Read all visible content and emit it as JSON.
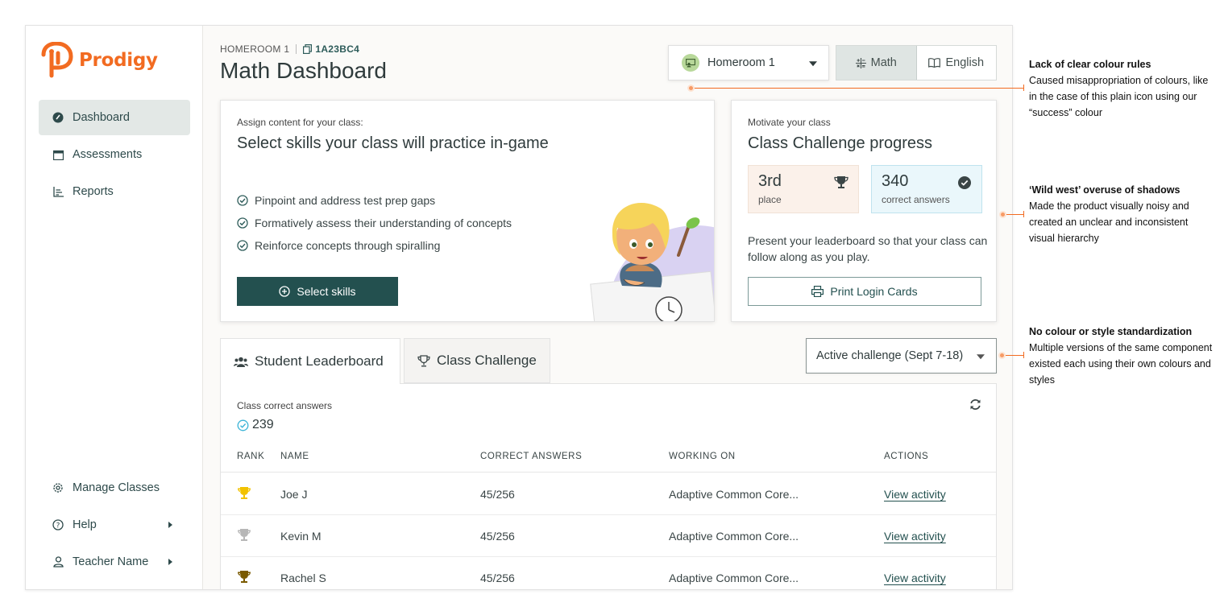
{
  "brand": {
    "name": "Prodigy",
    "color": "#f26b21"
  },
  "sidebar": {
    "items": [
      {
        "label": "Dashboard",
        "icon": "dashboard-gauge-icon",
        "active": true
      },
      {
        "label": "Assessments",
        "icon": "calendar-icon"
      },
      {
        "label": "Reports",
        "icon": "bar-chart-icon"
      }
    ],
    "bottom": [
      {
        "label": "Manage Classes",
        "icon": "gear-icon"
      },
      {
        "label": "Help",
        "icon": "help-circle-icon"
      },
      {
        "label": "Teacher Name",
        "icon": "user-icon"
      }
    ]
  },
  "header": {
    "homeroom": "HOMEROOM 1",
    "class_code": "1A23BC4",
    "title": "Math Dashboard",
    "class_select": "Homeroom 1",
    "subjects": [
      "Math",
      "English"
    ]
  },
  "skills_card": {
    "label": "Assign content for your class:",
    "title": "Select skills your class will practice in-game",
    "bullets": [
      "Pinpoint and address test prep gaps",
      "Formatively assess their understanding of concepts",
      "Reinforce concepts through spiralling"
    ],
    "button": "Select skills"
  },
  "challenge_card": {
    "label": "Motivate your class",
    "title": "Class Challenge progress",
    "place_value": "3rd",
    "place_label": "place",
    "answers_value": "340",
    "answers_label": "correct answers",
    "description": "Present your leaderboard so that your class can follow along as you play.",
    "button": "Print Login Cards"
  },
  "tabs": [
    "Student Leaderboard",
    "Class Challenge"
  ],
  "challenge_select": "Active challenge (Sept 7-18)",
  "leaderboard": {
    "label": "Class correct answers",
    "total": "239",
    "columns": [
      "RANK",
      "NAME",
      "CORRECT ANSWERS",
      "WORKING ON",
      "ACTIONS"
    ],
    "rows": [
      {
        "medal": "gold",
        "name": "Joe J",
        "answers": "45/256",
        "working": "Adaptive Common Core...",
        "action": "View activity"
      },
      {
        "medal": "silver",
        "name": "Kevin M",
        "answers": "45/256",
        "working": "Adaptive Common Core...",
        "action": "View activity"
      },
      {
        "medal": "bronze",
        "name": "Rachel S",
        "answers": "45/256",
        "working": "Adaptive Common Core...",
        "action": "View activity"
      }
    ],
    "medal_colors": {
      "gold": "#f2c200",
      "silver": "#b7b7b7",
      "bronze": "#7a5a00"
    }
  },
  "annotations": [
    {
      "title": "Lack of clear colour rules",
      "body": "Caused misappropriation of colours, like in the case of this plain icon using our “success” colour"
    },
    {
      "title": "‘Wild west’ overuse of shadows",
      "body": "Made the product visually noisy and created an unclear and inconsistent visual hierarchy"
    },
    {
      "title": "No colour or style standardization",
      "body": "Multiple versions of the same component existed each using their own colours and styles"
    }
  ]
}
